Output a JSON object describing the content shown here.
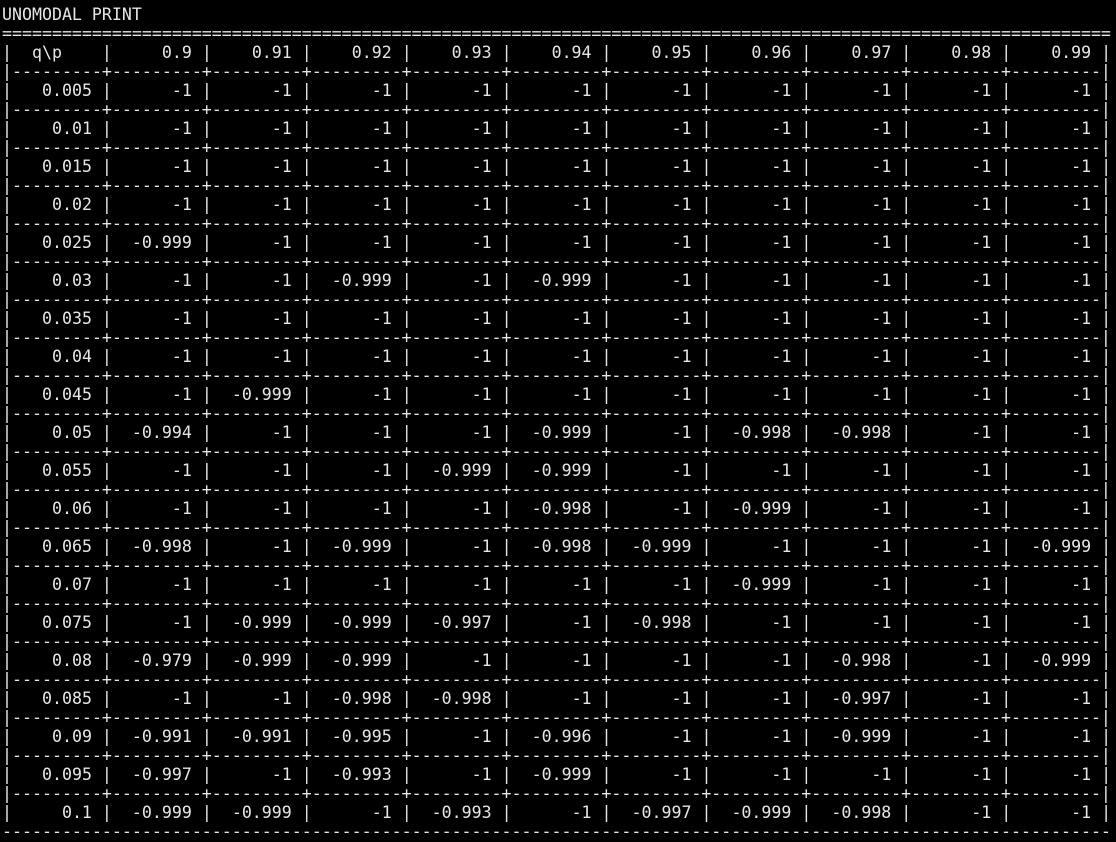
{
  "title": "UNOMODAL PRINT",
  "table": {
    "corner_label": "q\\p",
    "columns": [
      "0.9",
      "0.91",
      "0.92",
      "0.93",
      "0.94",
      "0.95",
      "0.96",
      "0.97",
      "0.98",
      "0.99"
    ],
    "rows": [
      {
        "q": "0.005",
        "values": [
          "-1",
          "-1",
          "-1",
          "-1",
          "-1",
          "-1",
          "-1",
          "-1",
          "-1",
          "-1"
        ]
      },
      {
        "q": "0.01",
        "values": [
          "-1",
          "-1",
          "-1",
          "-1",
          "-1",
          "-1",
          "-1",
          "-1",
          "-1",
          "-1"
        ]
      },
      {
        "q": "0.015",
        "values": [
          "-1",
          "-1",
          "-1",
          "-1",
          "-1",
          "-1",
          "-1",
          "-1",
          "-1",
          "-1"
        ]
      },
      {
        "q": "0.02",
        "values": [
          "-1",
          "-1",
          "-1",
          "-1",
          "-1",
          "-1",
          "-1",
          "-1",
          "-1",
          "-1"
        ]
      },
      {
        "q": "0.025",
        "values": [
          "-0.999",
          "-1",
          "-1",
          "-1",
          "-1",
          "-1",
          "-1",
          "-1",
          "-1",
          "-1"
        ]
      },
      {
        "q": "0.03",
        "values": [
          "-1",
          "-1",
          "-0.999",
          "-1",
          "-0.999",
          "-1",
          "-1",
          "-1",
          "-1",
          "-1"
        ]
      },
      {
        "q": "0.035",
        "values": [
          "-1",
          "-1",
          "-1",
          "-1",
          "-1",
          "-1",
          "-1",
          "-1",
          "-1",
          "-1"
        ]
      },
      {
        "q": "0.04",
        "values": [
          "-1",
          "-1",
          "-1",
          "-1",
          "-1",
          "-1",
          "-1",
          "-1",
          "-1",
          "-1"
        ]
      },
      {
        "q": "0.045",
        "values": [
          "-1",
          "-0.999",
          "-1",
          "-1",
          "-1",
          "-1",
          "-1",
          "-1",
          "-1",
          "-1"
        ]
      },
      {
        "q": "0.05",
        "values": [
          "-0.994",
          "-1",
          "-1",
          "-1",
          "-0.999",
          "-1",
          "-0.998",
          "-0.998",
          "-1",
          "-1"
        ]
      },
      {
        "q": "0.055",
        "values": [
          "-1",
          "-1",
          "-1",
          "-0.999",
          "-0.999",
          "-1",
          "-1",
          "-1",
          "-1",
          "-1"
        ]
      },
      {
        "q": "0.06",
        "values": [
          "-1",
          "-1",
          "-1",
          "-1",
          "-0.998",
          "-1",
          "-0.999",
          "-1",
          "-1",
          "-1"
        ]
      },
      {
        "q": "0.065",
        "values": [
          "-0.998",
          "-1",
          "-0.999",
          "-1",
          "-0.998",
          "-0.999",
          "-1",
          "-1",
          "-1",
          "-0.999"
        ]
      },
      {
        "q": "0.07",
        "values": [
          "-1",
          "-1",
          "-1",
          "-1",
          "-1",
          "-1",
          "-0.999",
          "-1",
          "-1",
          "-1"
        ]
      },
      {
        "q": "0.075",
        "values": [
          "-1",
          "-0.999",
          "-0.999",
          "-0.997",
          "-1",
          "-0.998",
          "-1",
          "-1",
          "-1",
          "-1"
        ]
      },
      {
        "q": "0.08",
        "values": [
          "-0.979",
          "-0.999",
          "-0.999",
          "-1",
          "-1",
          "-1",
          "-1",
          "-0.998",
          "-1",
          "-0.999"
        ]
      },
      {
        "q": "0.085",
        "values": [
          "-1",
          "-1",
          "-0.998",
          "-0.998",
          "-1",
          "-1",
          "-1",
          "-0.997",
          "-1",
          "-1"
        ]
      },
      {
        "q": "0.09",
        "values": [
          "-0.991",
          "-0.991",
          "-0.995",
          "-1",
          "-0.996",
          "-1",
          "-1",
          "-0.999",
          "-1",
          "-1"
        ]
      },
      {
        "q": "0.095",
        "values": [
          "-0.997",
          "-1",
          "-0.993",
          "-1",
          "-0.999",
          "-1",
          "-1",
          "-1",
          "-1",
          "-1"
        ]
      },
      {
        "q": "0.1",
        "values": [
          "-0.999",
          "-0.999",
          "-1",
          "-0.993",
          "-1",
          "-0.997",
          "-0.999",
          "-0.998",
          "-1",
          "-1"
        ]
      }
    ]
  }
}
